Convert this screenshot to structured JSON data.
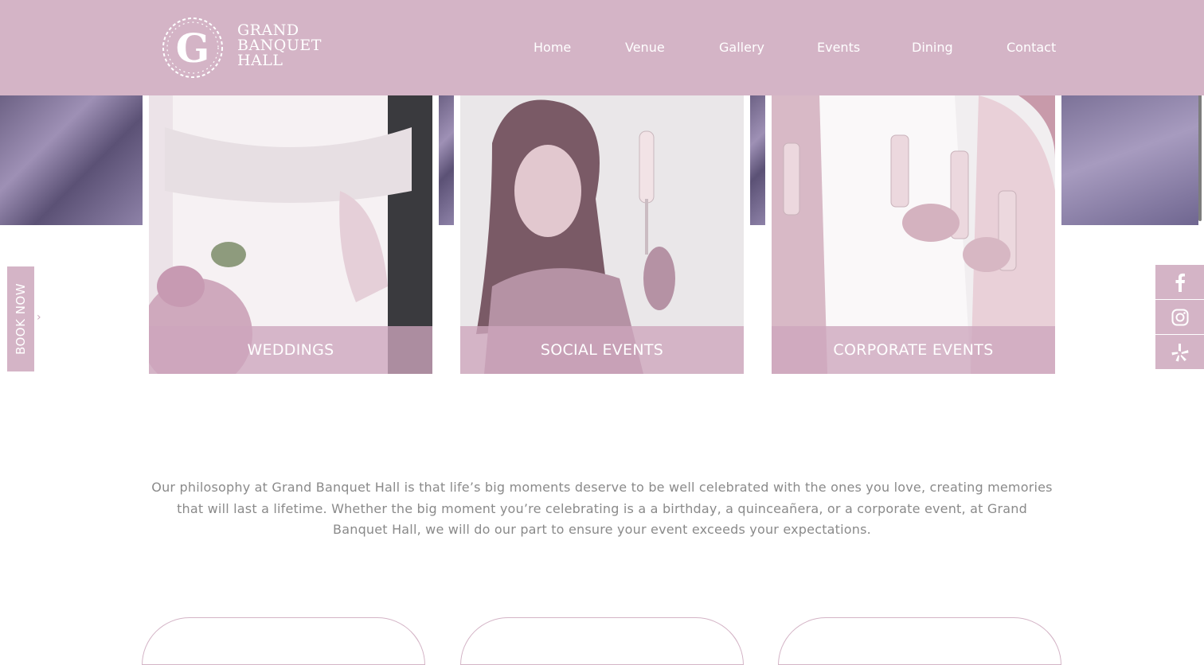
{
  "header": {
    "logo": {
      "monogram": "G",
      "lines": [
        "GRAND",
        "BANQUET",
        "HALL"
      ]
    },
    "nav": [
      {
        "label": "Home"
      },
      {
        "label": "Venue"
      },
      {
        "label": "Gallery"
      },
      {
        "label": "Events"
      },
      {
        "label": "Dining"
      },
      {
        "label": "Contact"
      }
    ]
  },
  "cards": [
    {
      "label": "WEDDINGS",
      "image": "wedding-dress-photo"
    },
    {
      "label": "SOCIAL EVENTS",
      "image": "woman-with-champagne-photo"
    },
    {
      "label": "CORPORATE EVENTS",
      "image": "champagne-toast-photo"
    }
  ],
  "book_now": {
    "label": "BOOK NOW"
  },
  "social": [
    {
      "icon": "facebook-icon"
    },
    {
      "icon": "instagram-icon"
    },
    {
      "icon": "yelp-icon"
    }
  ],
  "philosophy": {
    "text": "Our philosophy at Grand Banquet Hall is that life’s big moments deserve to be well celebrated with the ones you love, creating memories that will last a lifetime. Whether the big moment you’re celebrating is a a birthday, a quinceañera, or a corporate event, at Grand Banquet Hall, we will do our part to ensure your event exceeds your expectations."
  },
  "colors": {
    "brand": "#d4b4c6",
    "body_text": "#8a8a8a"
  }
}
